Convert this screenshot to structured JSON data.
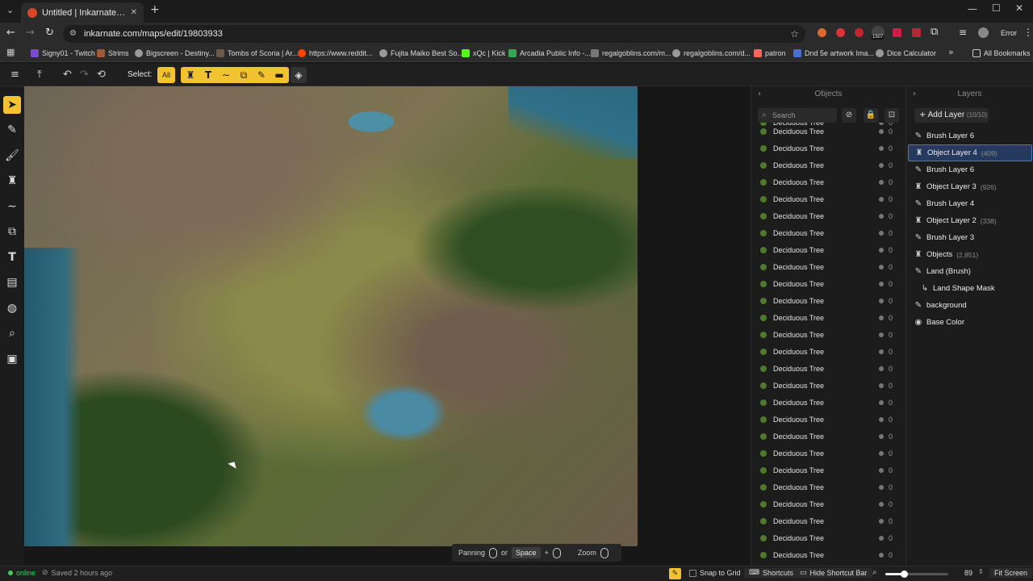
{
  "browser": {
    "tab_title": "Untitled | Inkarnate - Create Fa",
    "url": "inkarnate.com/maps/edit/19803933",
    "profile_label": "Error",
    "bookmarks": [
      "Signy01 - Twitch",
      "Strims",
      "Bigscreen - Destiny...",
      "Tombs of Scoria | Ar...",
      "https://www.reddit...",
      "Fujita Maiko Best So...",
      "xQc | Kick",
      "Arcadia Public Info -...",
      "regalgoblins.com/m...",
      "regalgoblins.com/d...",
      "patron",
      "Dnd 5e artwork Ima...",
      "Dice Calculator"
    ],
    "all_bookmarks": "All Bookmarks",
    "badge_count": "1507"
  },
  "toolbar": {
    "select_label": "Select:",
    "all_label": "All"
  },
  "objects_panel": {
    "title": "Objects",
    "search_placeholder": "Search",
    "rows": [
      {
        "name": "Deciduous Tree",
        "count": "0"
      },
      {
        "name": "Deciduous Tree",
        "count": "0"
      },
      {
        "name": "Deciduous Tree",
        "count": "0"
      },
      {
        "name": "Deciduous Tree",
        "count": "0"
      },
      {
        "name": "Deciduous Tree",
        "count": "0"
      },
      {
        "name": "Deciduous Tree",
        "count": "0"
      },
      {
        "name": "Deciduous Tree",
        "count": "0"
      },
      {
        "name": "Deciduous Tree",
        "count": "0"
      },
      {
        "name": "Deciduous Tree",
        "count": "0"
      },
      {
        "name": "Deciduous Tree",
        "count": "0"
      },
      {
        "name": "Deciduous Tree",
        "count": "0"
      },
      {
        "name": "Deciduous Tree",
        "count": "0"
      },
      {
        "name": "Deciduous Tree",
        "count": "0"
      },
      {
        "name": "Deciduous Tree",
        "count": "0"
      },
      {
        "name": "Deciduous Tree",
        "count": "0"
      },
      {
        "name": "Deciduous Tree",
        "count": "0"
      },
      {
        "name": "Deciduous Tree",
        "count": "0"
      },
      {
        "name": "Deciduous Tree",
        "count": "0"
      },
      {
        "name": "Deciduous Tree",
        "count": "0"
      },
      {
        "name": "Deciduous Tree",
        "count": "0"
      },
      {
        "name": "Deciduous Tree",
        "count": "0"
      },
      {
        "name": "Deciduous Tree",
        "count": "0"
      },
      {
        "name": "Deciduous Tree",
        "count": "0"
      },
      {
        "name": "Deciduous Tree",
        "count": "0"
      },
      {
        "name": "Deciduous Tree",
        "count": "0"
      },
      {
        "name": "Deciduous Tree",
        "count": "0"
      },
      {
        "name": "Deciduous Tree",
        "count": "0"
      }
    ]
  },
  "layers_panel": {
    "title": "Layers",
    "add_layer": "Add Layer",
    "layer_count": "(10/10)",
    "layers": [
      {
        "name": "Brush Layer 6",
        "count": "",
        "icon": "brush-icon",
        "active": false
      },
      {
        "name": "Object Layer 4",
        "count": "(409)",
        "icon": "object-icon",
        "active": true
      },
      {
        "name": "Brush Layer 6",
        "count": "",
        "icon": "brush-icon",
        "active": false
      },
      {
        "name": "Object Layer 3",
        "count": "(926)",
        "icon": "object-icon",
        "active": false
      },
      {
        "name": "Brush Layer 4",
        "count": "",
        "icon": "brush-icon",
        "active": false
      },
      {
        "name": "Object Layer 2",
        "count": "(338)",
        "icon": "object-icon",
        "active": false
      },
      {
        "name": "Brush Layer 3",
        "count": "",
        "icon": "brush-icon",
        "active": false
      },
      {
        "name": "Objects",
        "count": "(2,851)",
        "icon": "object-icon",
        "active": false
      },
      {
        "name": "Land (Brush)",
        "count": "",
        "icon": "brush-icon",
        "active": false
      },
      {
        "name": "Land Shape Mask",
        "count": "",
        "icon": "mask-icon",
        "active": false
      },
      {
        "name": "background",
        "count": "",
        "icon": "brush-icon",
        "active": false
      },
      {
        "name": "Base Color",
        "count": "",
        "icon": "palette-icon",
        "active": false
      }
    ]
  },
  "shortcut_bar": {
    "panning": "Panning",
    "or": "or",
    "space": "Space",
    "plus": "+",
    "zoom": "Zoom"
  },
  "status": {
    "online": "online",
    "saved": "Saved 2 hours ago",
    "snap_to_grid": "Snap to Grid",
    "shortcuts": "Shortcuts",
    "hide_shortcut_bar": "Hide Shortcut Bar",
    "zoom_value": "89",
    "zoom_fraction": 0.3,
    "fit_screen": "Fit Screen"
  },
  "colors": {
    "accent": "#f2c230",
    "active_layer": "#263a5e",
    "online": "#3ecf5c"
  }
}
